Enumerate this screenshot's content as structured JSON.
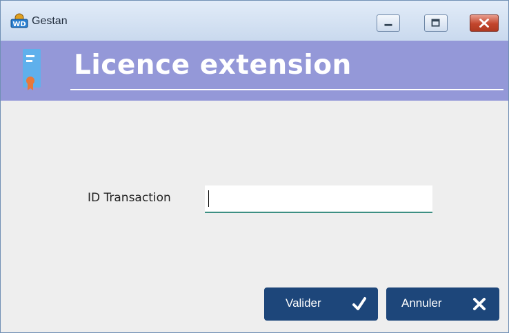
{
  "window": {
    "title": "Gestan",
    "controls": [
      "minimize",
      "maximize",
      "close"
    ]
  },
  "header": {
    "title": "Licence extension",
    "icon": "certificate-document-icon",
    "band_color": "#9498d8"
  },
  "form": {
    "transaction_id": {
      "label": "ID Transaction",
      "value": ""
    }
  },
  "buttons": {
    "ok": {
      "label": "Valider",
      "icon": "checkmark-icon"
    },
    "cancel": {
      "label": "Annuler",
      "icon": "cross-icon"
    }
  },
  "colors": {
    "button_bg": "#1d467a",
    "input_underline": "#3d8f83"
  }
}
